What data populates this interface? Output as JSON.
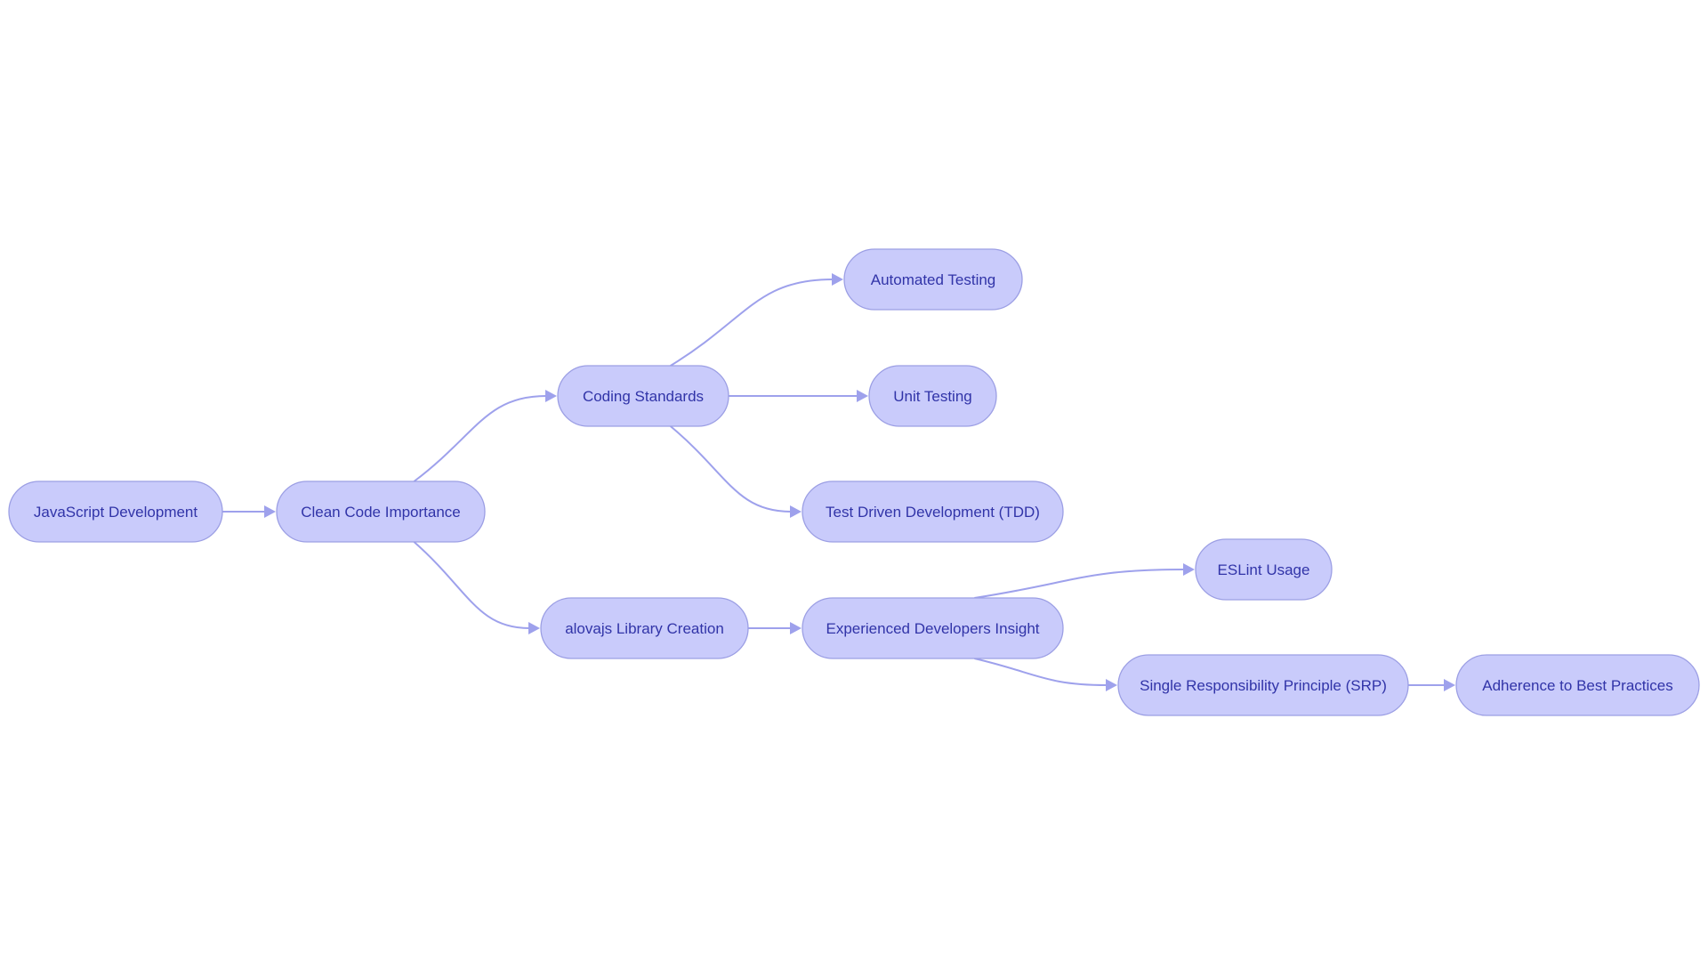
{
  "diagram": {
    "type": "flowchart",
    "direction": "left-to-right",
    "colors": {
      "node_fill": "#C9CBFB",
      "node_stroke": "#9C9FE4",
      "text": "#3134A8",
      "edge": "#9EA1EC",
      "background": "#FFFFFF"
    },
    "nodes": [
      {
        "id": "A",
        "label": "JavaScript Development"
      },
      {
        "id": "B",
        "label": "Clean Code Importance"
      },
      {
        "id": "C",
        "label": "Coding Standards"
      },
      {
        "id": "D",
        "label": "Automated Testing"
      },
      {
        "id": "E",
        "label": "Unit Testing"
      },
      {
        "id": "F",
        "label": "Test Driven Development (TDD)"
      },
      {
        "id": "G",
        "label": "alovajs Library Creation"
      },
      {
        "id": "H",
        "label": "Experienced Developers Insight"
      },
      {
        "id": "I",
        "label": "ESLint Usage"
      },
      {
        "id": "J",
        "label": "Single Responsibility Principle (SRP)"
      },
      {
        "id": "K",
        "label": "Adherence to Best Practices"
      }
    ],
    "edges": [
      {
        "from": "A",
        "to": "B"
      },
      {
        "from": "B",
        "to": "C"
      },
      {
        "from": "B",
        "to": "G"
      },
      {
        "from": "C",
        "to": "D"
      },
      {
        "from": "C",
        "to": "E"
      },
      {
        "from": "C",
        "to": "F"
      },
      {
        "from": "G",
        "to": "H"
      },
      {
        "from": "H",
        "to": "I"
      },
      {
        "from": "H",
        "to": "J"
      },
      {
        "from": "J",
        "to": "K"
      }
    ]
  }
}
